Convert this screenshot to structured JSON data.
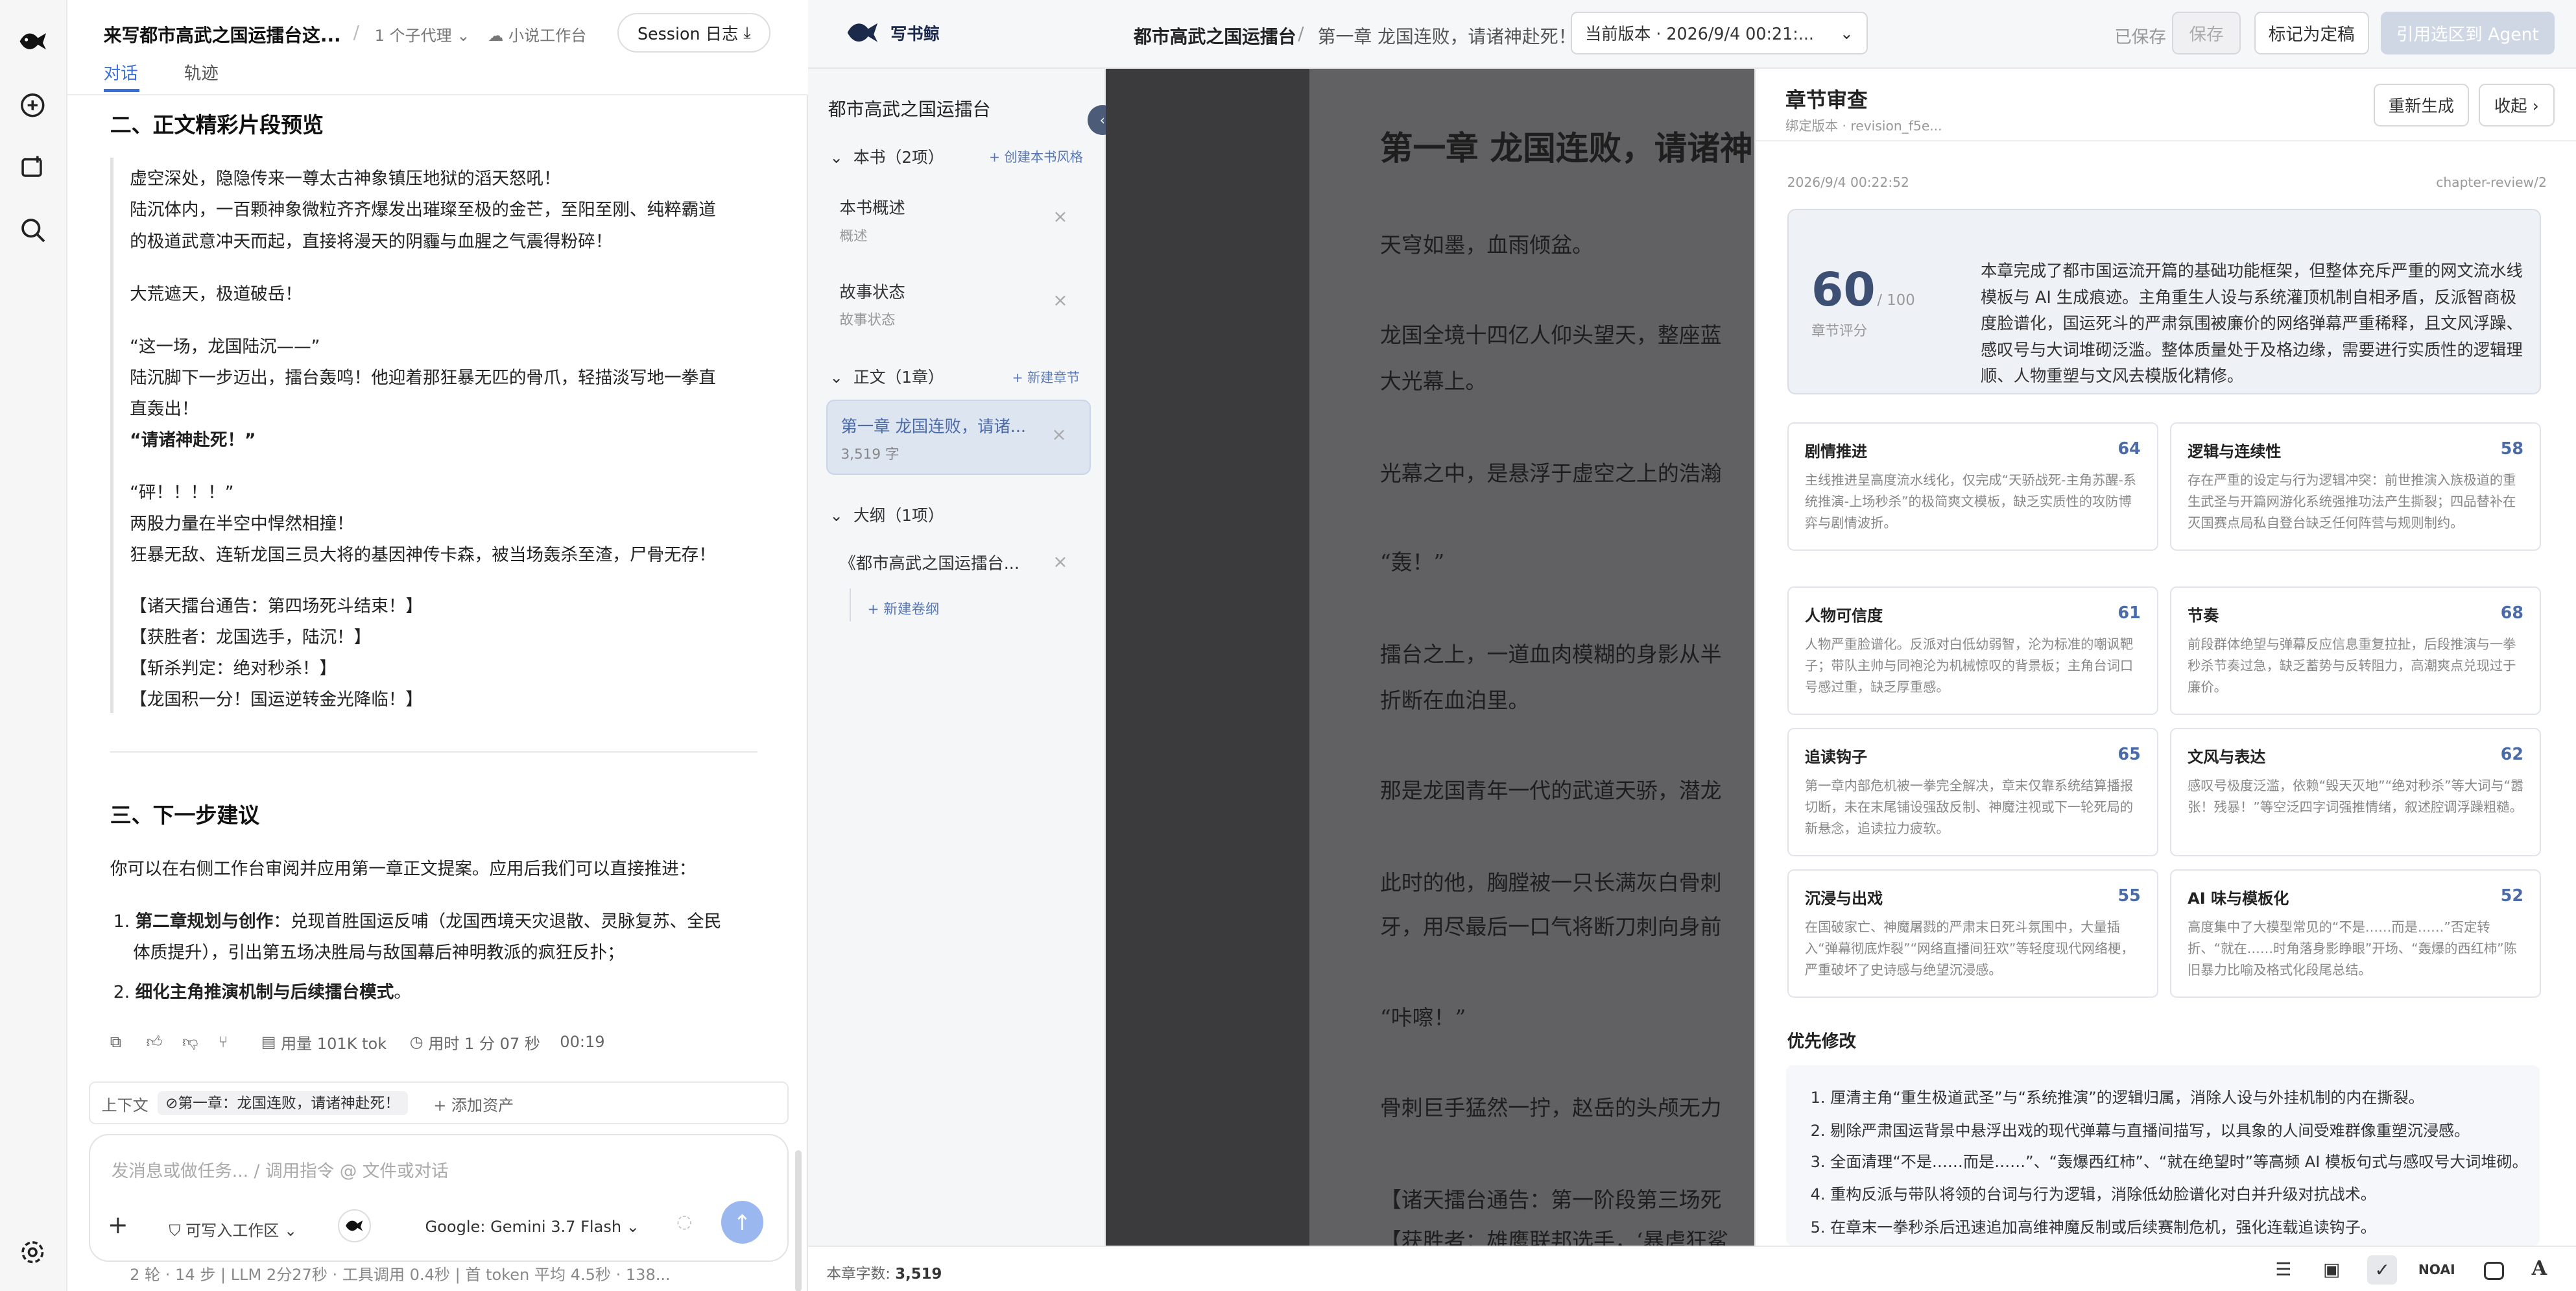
{
  "chat": {
    "title": "来写都市高武之国运擂台这...",
    "agents": "1 个子代理",
    "workspace": "小说工作台",
    "session_log": "Session 日志",
    "tabs": [
      "对话",
      "轨迹"
    ],
    "section2": "二、正文精彩片段预览",
    "excerpt": [
      "虚空深处，隐隐传来一尊太古神象镇压地狱的滔天怒吼！",
      "陆沉体内，一百颗神象微粒齐齐爆发出璀璨至极的金芒，至阳至刚、纯粹霸道",
      "的极道武意冲天而起，直接将漫天的阴霾与血腥之气震得粉碎！",
      "大荒遮天，极道破岳！",
      "“这一场，龙国陆沉——”",
      "陆沉脚下一步迈出，擂台轰鸣！他迎着那狂暴无匹的骨爪，轻描淡写地一拳直",
      "直轰出！",
      "“请诸神赴死！”",
      "“砰！！！！”",
      "两股力量在半空中悍然相撞！",
      "狂暴无敌、连斩龙国三员大将的基因神传卡森，被当场轰杀至渣，尸骨无存！",
      "【诸天擂台通告：第四场死斗结束！】",
      "【获胜者：龙国选手，陆沉！】",
      "【斩杀判定：绝对秒杀！】",
      "【龙国积一分！国运逆转金光降临！】"
    ],
    "section3": "三、下一步建议",
    "next_intro": "你可以在右侧工作台审阅并应用第一章正文提案。应用后我们可以直接推进：",
    "next_items": [
      {
        "num": "1.",
        "bold": "第二章规划与创作",
        "rest": "：兑现首胜国运反哺（龙国西境天灾退散、灵脉复苏、全民"
      },
      {
        "num": "",
        "bold": "",
        "rest": "体质提升），引出第五场决胜局与敌国幕后神明教派的疯狂反扑；"
      },
      {
        "num": "2.",
        "bold": "细化主角推演机制与后续擂台模式",
        "rest": "。"
      }
    ],
    "usage": "用量 101K tok",
    "duration": "用时 1 分 07 秒",
    "clock": "00:19",
    "context_label": "上下文",
    "context_chip": "第一章：龙国连败，请诸神赴死！",
    "add_asset": "+ 添加资产",
    "input_placeholder": "发消息或做任务... / 调用指令 @ 文件或对话",
    "mode": "可写入工作区",
    "model": "Google: Gemini 3.7 Flash",
    "stats": "2 轮 · 14 步  |  LLM 2分27秒 · 工具调用 0.4秒  |  首 token 平均 4.5秒 · 138..."
  },
  "header": {
    "brand": "写书鲸",
    "book": "都市高武之国运擂台",
    "slash": "/",
    "chapter": "第一章 龙国连败，请诸神赴死！",
    "version": "当前版本 · 2026/9/4 00:21:...",
    "saved": "已保存",
    "save": "保存",
    "finalize": "标记为定稿",
    "quote_agent": "引用选区到 Agent"
  },
  "tree": {
    "book_title": "都市高武之国运擂台",
    "book_group": "本书（2项）",
    "create_style": "+ 创建本书风格",
    "items": [
      {
        "title": "本书概述",
        "sub": "概述"
      },
      {
        "title": "故事状态",
        "sub": "故事状态"
      }
    ],
    "body_group": "正文（1章）",
    "new_chapter": "+ 新建章节",
    "chapter_title": "第一章 龙国连败，请诸...",
    "chapter_words": "3,519 字",
    "outline_group": "大纲（1项）",
    "outline_item": "《都市高武之国运擂台...",
    "new_volume": "+ 新建卷纲"
  },
  "editor": {
    "title": "第一章 龙国连败，请诸神",
    "lines": [
      "天穹如墨，血雨倾盆。",
      "龙国全境十四亿人仰头望天，整座蓝",
      "大光幕上。",
      "光幕之中，是悬浮于虚空之上的浩瀚",
      "“轰！”",
      "擂台之上，一道血肉模糊的身影从半",
      "折断在血泊里。",
      "那是龙国青年一代的武道天骄，潜龙",
      "此时的他，胸膛被一只长满灰白骨刺",
      "牙，用尽最后一口气将断刀刺向身前",
      "“咔嚓！”",
      "骨刺巨手猛然一拧，赵岳的头颅无力",
      "【诸天擂台通告：第一阶段第三场死",
      "【获胜者：雄鹰联邦选手，‘暴虐狂鲨"
    ]
  },
  "review": {
    "title": "章节审查",
    "bound": "绑定版本 · revision_f5e...",
    "regenerate": "重新生成",
    "collapse": "收起 ›",
    "timestamp": "2026/9/4 00:22:52",
    "review_id": "chapter-review/2",
    "score": "60",
    "score_max": "/ 100",
    "score_label": "章节评分",
    "summary": "本章完成了都市国运流开篇的基础功能框架，但整体充斥严重的网文流水线模板与 AI 生成痕迹。主角重生人设与系统灌顶机制自相矛盾，反派智商极度脸谱化，国运死斗的严肃氛围被廉价的网络弹幕严重稀释，且文风浮躁、感叹号与大词堆砌泛滥。整体质量处于及格边缘，需要进行实质性的逻辑理顺、人物重塑与文风去模版化精修。",
    "cards": [
      {
        "title": "剧情推进",
        "score": "64",
        "desc": "主线推进呈高度流水线化，仅完成“天骄战死-主角苏醒-系统推演-上场秒杀”的极简爽文模板，缺乏实质性的攻防博弈与剧情波折。"
      },
      {
        "title": "逻辑与连续性",
        "score": "58",
        "desc": "存在严重的设定与行为逻辑冲突：前世推演入族极道的重生武圣与开篇网游化系统强推功法产生撕裂；四品替补在灭国赛点局私自登台缺乏任何阵营与规则制约。"
      },
      {
        "title": "人物可信度",
        "score": "61",
        "desc": "人物严重脸谱化。反派对白低幼弱智，沦为标准的嘲讽靶子；带队主帅与同袍沦为机械惊叹的背景板；主角台词口号感过重，缺乏厚重感。"
      },
      {
        "title": "节奏",
        "score": "68",
        "desc": "前段群体绝望与弹幕反应信息重复拉扯，后段推演与一拳秒杀节奏过急，缺乏蓄势与反转阻力，高潮爽点兑现过于廉价。"
      },
      {
        "title": "追读钩子",
        "score": "65",
        "desc": "第一章内部危机被一拳完全解决，章末仅靠系统结算播报切断，未在末尾铺设强敌反制、神魔注视或下一轮死局的新悬念，追读拉力疲软。"
      },
      {
        "title": "文风与表达",
        "score": "62",
        "desc": "感叹号极度泛滥，依赖“毁天灭地”“绝对秒杀”等大词与“嚣张！残暴！”等空泛四字词强推情绪，叙述腔调浮躁粗糙。"
      },
      {
        "title": "沉浸与出戏",
        "score": "55",
        "desc": "在国破家亡、神魔屠戮的严肃末日死斗氛围中，大量插入“弹幕彻底炸裂”“网络直播间狂欢”等轻度现代网络梗，严重破坏了史诗感与绝望沉浸感。"
      },
      {
        "title": "AI 味与模板化",
        "score": "52",
        "desc": "高度集中了大模型常见的“不是……而是……”否定转折、“就在……时角落身影睁眼”开场、“轰爆的西红柿”陈旧暴力比喻及格式化段尾总结。"
      }
    ],
    "priority_title": "优先修改",
    "priority": [
      "1. 厘清主角“重生极道武圣”与“系统推演”的逻辑归属，消除人设与外挂机制的内在撕裂。",
      "2. 剔除严肃国运背景中悬浮出戏的现代弹幕与直播间描写，以具象的人间受难群像重塑沉浸感。",
      "3. 全面清理“不是……而是……”、“轰爆西红柿”、“就在绝望时”等高频 AI 模板句式与感叹号大词堆砌。",
      "4. 重构反派与带队将领的台词与行为逻辑，消除低幼脸谱化对白并升级对抗战术。",
      "5. 在章末一拳秒杀后迅速追加高维神魔反制或后续赛制危机，强化连载追读钩子。"
    ]
  },
  "status": {
    "word_label": "本章字数:",
    "word_count": "3,519",
    "noai": "NOAI"
  }
}
